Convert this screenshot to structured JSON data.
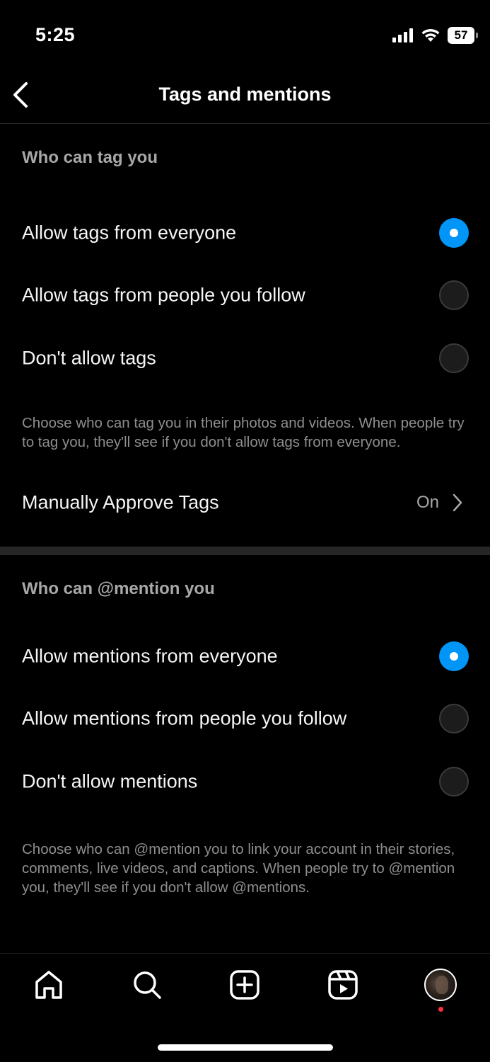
{
  "status_bar": {
    "time": "5:25",
    "battery": "57",
    "icons": [
      "signal-icon",
      "wifi-icon",
      "battery-icon"
    ]
  },
  "header": {
    "title": "Tags and mentions",
    "back_icon": "chevron-left-icon"
  },
  "tags": {
    "label": "Who can tag you",
    "options": [
      {
        "label": "Allow tags from everyone",
        "selected": true
      },
      {
        "label": "Allow tags from people you follow",
        "selected": false
      },
      {
        "label": "Don't allow tags",
        "selected": false
      }
    ],
    "helper": "Choose who can tag you in their photos and videos. When people try to tag you, they'll see if you don't allow tags from everyone.",
    "manual_approve": {
      "label": "Manually Approve Tags",
      "value": "On"
    }
  },
  "mentions": {
    "label": "Who can @mention you",
    "options": [
      {
        "label": "Allow mentions from everyone",
        "selected": true
      },
      {
        "label": "Allow mentions from people you follow",
        "selected": false
      },
      {
        "label": "Don't allow mentions",
        "selected": false
      }
    ],
    "helper": "Choose who can @mention you to link your account in their stories, comments, live videos, and captions. When people try to @mention you, they'll see if you don't allow @mentions."
  },
  "tab_bar": {
    "tabs": [
      "home-icon",
      "search-icon",
      "create-icon",
      "reels-icon",
      "profile-avatar"
    ]
  },
  "colors": {
    "accent": "#0095f6",
    "background": "#000000",
    "secondary_text": "#8e8e8e",
    "notification": "#ff3040"
  }
}
